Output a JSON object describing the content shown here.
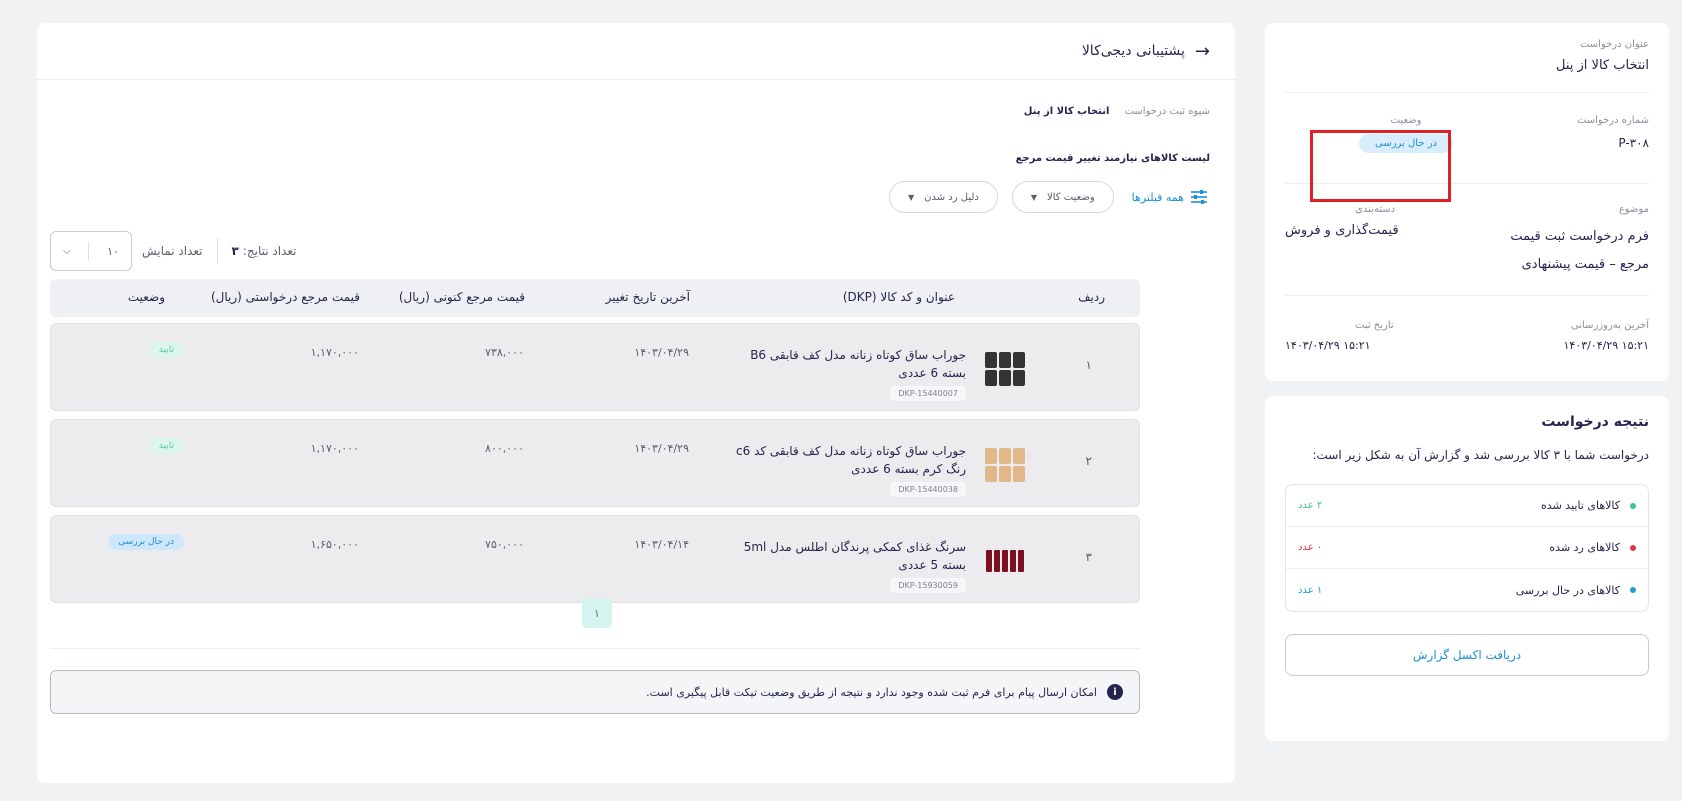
{
  "request_info": {
    "title_label": "عنوان درخواست",
    "title_value": "انتخاب کالا از پنل",
    "number_label": "شماره درخواست",
    "number_value": "P-۳۰۸",
    "status_label": "وضعیت",
    "status_value": "در حال بررسی",
    "subject_label": "موضوع",
    "subject_value": "فرم درخواست ثبت قیمت مرجع – قیمت پیشنهادی",
    "category_label": "دسته‌بندی",
    "category_value": "قیمت‌گذاری و فروش",
    "updated_label": "آخرین به‌روزرسانی",
    "updated_value": "۱۵:۲۱ ۱۴۰۳/۰۴/۲۹",
    "created_label": "تاریخ ثبت",
    "created_value": "۱۵:۲۱ ۱۴۰۳/۰۴/۲۹"
  },
  "result": {
    "title": "نتیجه درخواست",
    "description": "درخواست شما با ۳ کالا بررسی شد و گزارش آن به شکل زیر است:",
    "rows": [
      {
        "label": "کالاهای تایید شده",
        "count": "۲ عدد",
        "color": "#3ec29a"
      },
      {
        "label": "کالاهای رد شده",
        "count": "۰ عدد",
        "color": "#e5334b"
      },
      {
        "label": "کالاهای در حال بررسی",
        "count": "۱ عدد",
        "color": "#1d9fd6"
      }
    ],
    "excel_button": "دریافت اکسل گزارش"
  },
  "main": {
    "header_title": "پشتیبانی دیجی‌کالا",
    "reg_method_label": "شیوه ثبت درخواست",
    "reg_method_value": "انتخاب کالا از پنل",
    "list_title": "لیست کالاهای نیازمند تغییر قیمت مرجع",
    "filters": {
      "all_label": "همه فیلترها",
      "status_filter": "وضعیت کالا",
      "reject_filter": "دلیل رد شدن"
    },
    "results_label": "تعداد نتایج:",
    "results_count": "۳",
    "page_size_label": "تعداد نمایش",
    "page_size_value": "۱۰",
    "columns": {
      "index": "ردیف",
      "title": "عنوان و کد کالا (DKP)",
      "last_change": "آخرین تاریخ تغییر",
      "current_price": "قیمت مرجع کنونی (ریال)",
      "requested_price": "قیمت مرجع درخواستی (ریال)",
      "status": "وضعیت"
    },
    "rows": [
      {
        "index": "۱",
        "title": "جوراب ساق کوتاه زنانه مدل کف قابقی B6 بسته 6 عددی",
        "dkp": "DKP-15440007",
        "last_change": "۱۴۰۳/۰۴/۲۹",
        "current_price": "۷۳۸,۰۰۰",
        "requested_price": "۱,۱۷۰,۰۰۰",
        "status": "تایید",
        "status_kind": "approved",
        "thumb": "black-socks"
      },
      {
        "index": "۲",
        "title": "جوراب ساق کوتاه زنانه مدل کف قابقی کد c6 رنگ کرم بسته 6 عددی",
        "dkp": "DKP-15440038",
        "last_change": "۱۴۰۳/۰۴/۲۹",
        "current_price": "۸۰۰,۰۰۰",
        "requested_price": "۱,۱۷۰,۰۰۰",
        "status": "تایید",
        "status_kind": "approved",
        "thumb": "cream-socks"
      },
      {
        "index": "۳",
        "title": "سرنگ غذای کمکی پرندگان اطلس مدل 5ml بسته 5 عددی",
        "dkp": "DKP-15930059",
        "last_change": "۱۴۰۳/۰۴/۱۴",
        "current_price": "۷۵۰,۰۰۰",
        "requested_price": "۱,۶۵۰,۰۰۰",
        "status": "در حال بررسی",
        "status_kind": "review",
        "thumb": "syringes"
      }
    ],
    "pagination_current": "۱",
    "notice": "امکان ارسال پیام برای فرم ثبت شده وجود ندارد و نتیجه از طریق وضعیت تیکت قابل پیگیری است."
  }
}
